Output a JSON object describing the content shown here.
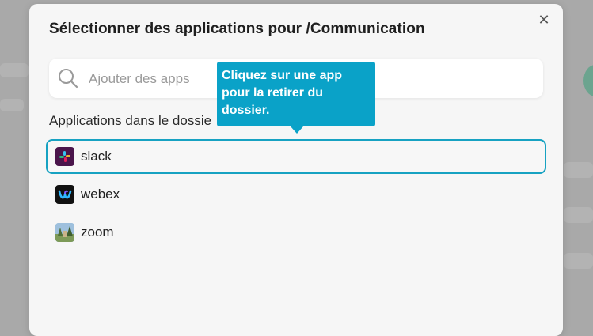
{
  "dialog": {
    "title": "Sélectionner des applications pour /Communication",
    "close_icon": "close-icon"
  },
  "search": {
    "placeholder": "Ajouter des apps",
    "value": "",
    "icon": "search-icon"
  },
  "folder": {
    "label": "Applications dans le dossie"
  },
  "apps": [
    {
      "name": "slack",
      "icon": "slack-icon",
      "selected": true
    },
    {
      "name": "webex",
      "icon": "webex-icon",
      "selected": false
    },
    {
      "name": "zoom",
      "icon": "zoom-icon",
      "selected": false
    }
  ],
  "tooltip": {
    "text": "Cliquez sur une app pour la retirer du dossier."
  },
  "colors": {
    "accent": "#17a2c2",
    "tooltip_bg": "#0aa2c8"
  }
}
